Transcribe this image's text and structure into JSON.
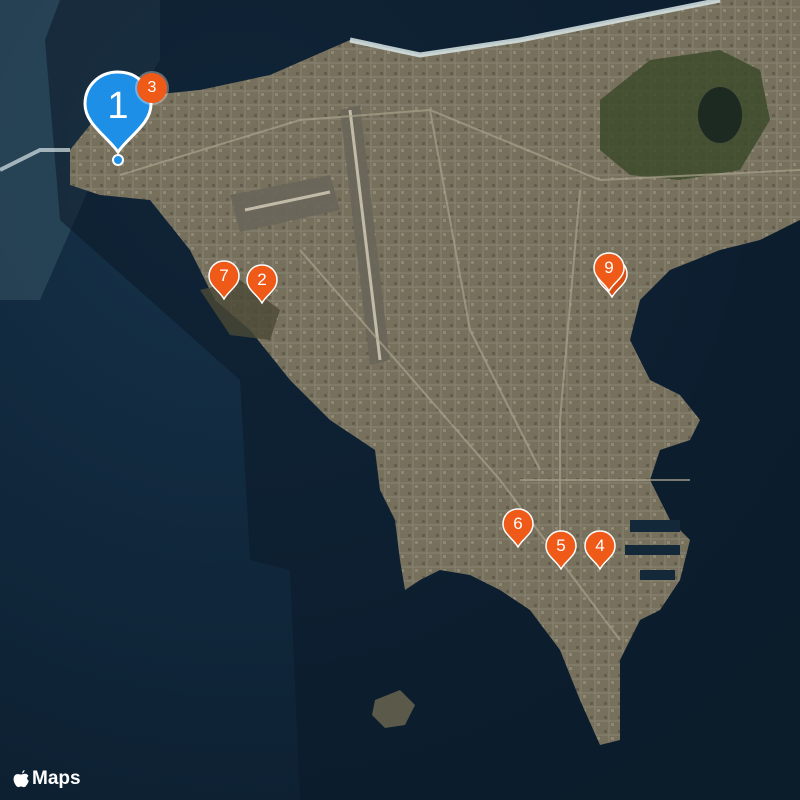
{
  "map": {
    "style": "satellite",
    "colors": {
      "ocean": "#0f2436",
      "land": "#5a5a48",
      "land_urban": "#7a7563",
      "vegetation": "#3f4a2c",
      "surf": "#d9e6e6",
      "pin_orange": "#ef5a18",
      "pin_blue": "#1e8fe6"
    }
  },
  "markers": [
    {
      "label": "1",
      "style": "blue-cluster-pin",
      "badge": "3"
    },
    {
      "label": "2",
      "style": "orange-pin"
    },
    {
      "label": "4",
      "style": "orange-pin"
    },
    {
      "label": "5",
      "style": "orange-pin"
    },
    {
      "label": "6",
      "style": "orange-pin"
    },
    {
      "label": "7",
      "style": "orange-pin"
    },
    {
      "label": "9",
      "style": "orange-pin"
    }
  ],
  "attribution": {
    "logo_icon": "apple-logo-icon",
    "text": "Maps"
  }
}
